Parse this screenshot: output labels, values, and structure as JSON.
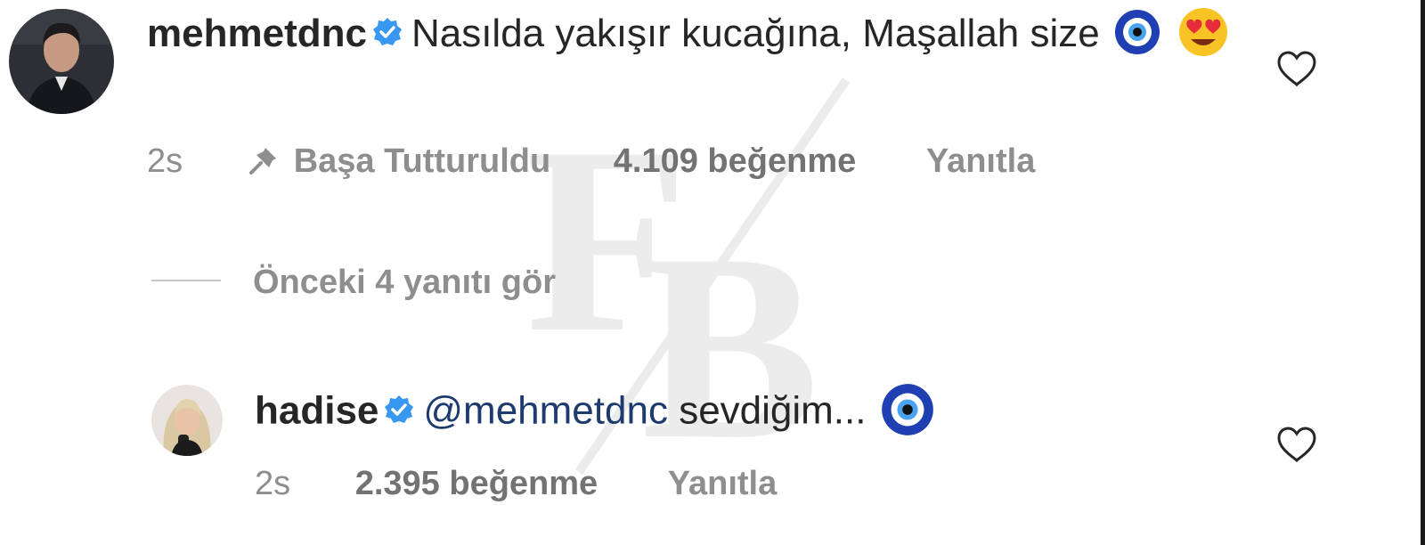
{
  "comments": [
    {
      "username": "mehmetdnc",
      "text": "Nasılda yakışır kucağına, Maşallah size",
      "emojis": [
        "nazar-boncugu",
        "heart-eyes"
      ],
      "time": "2s",
      "pinned_label": "Başa Tutturuldu",
      "likes": "4.109 beğenme",
      "reply_label": "Yanıtla"
    }
  ],
  "view_replies_label": "Önceki 4 yanıtı gör",
  "reply": {
    "username": "hadise",
    "mention": "@mehmetdnc",
    "text": "sevdiğim...",
    "emojis": [
      "nazar-boncugu"
    ],
    "time": "2s",
    "likes": "2.395 beğenme",
    "reply_label": "Yanıtla"
  },
  "colors": {
    "text": "#262626",
    "meta": "#8e8e8e",
    "verified": "#3897f0",
    "mention": "#1d3b6e"
  }
}
